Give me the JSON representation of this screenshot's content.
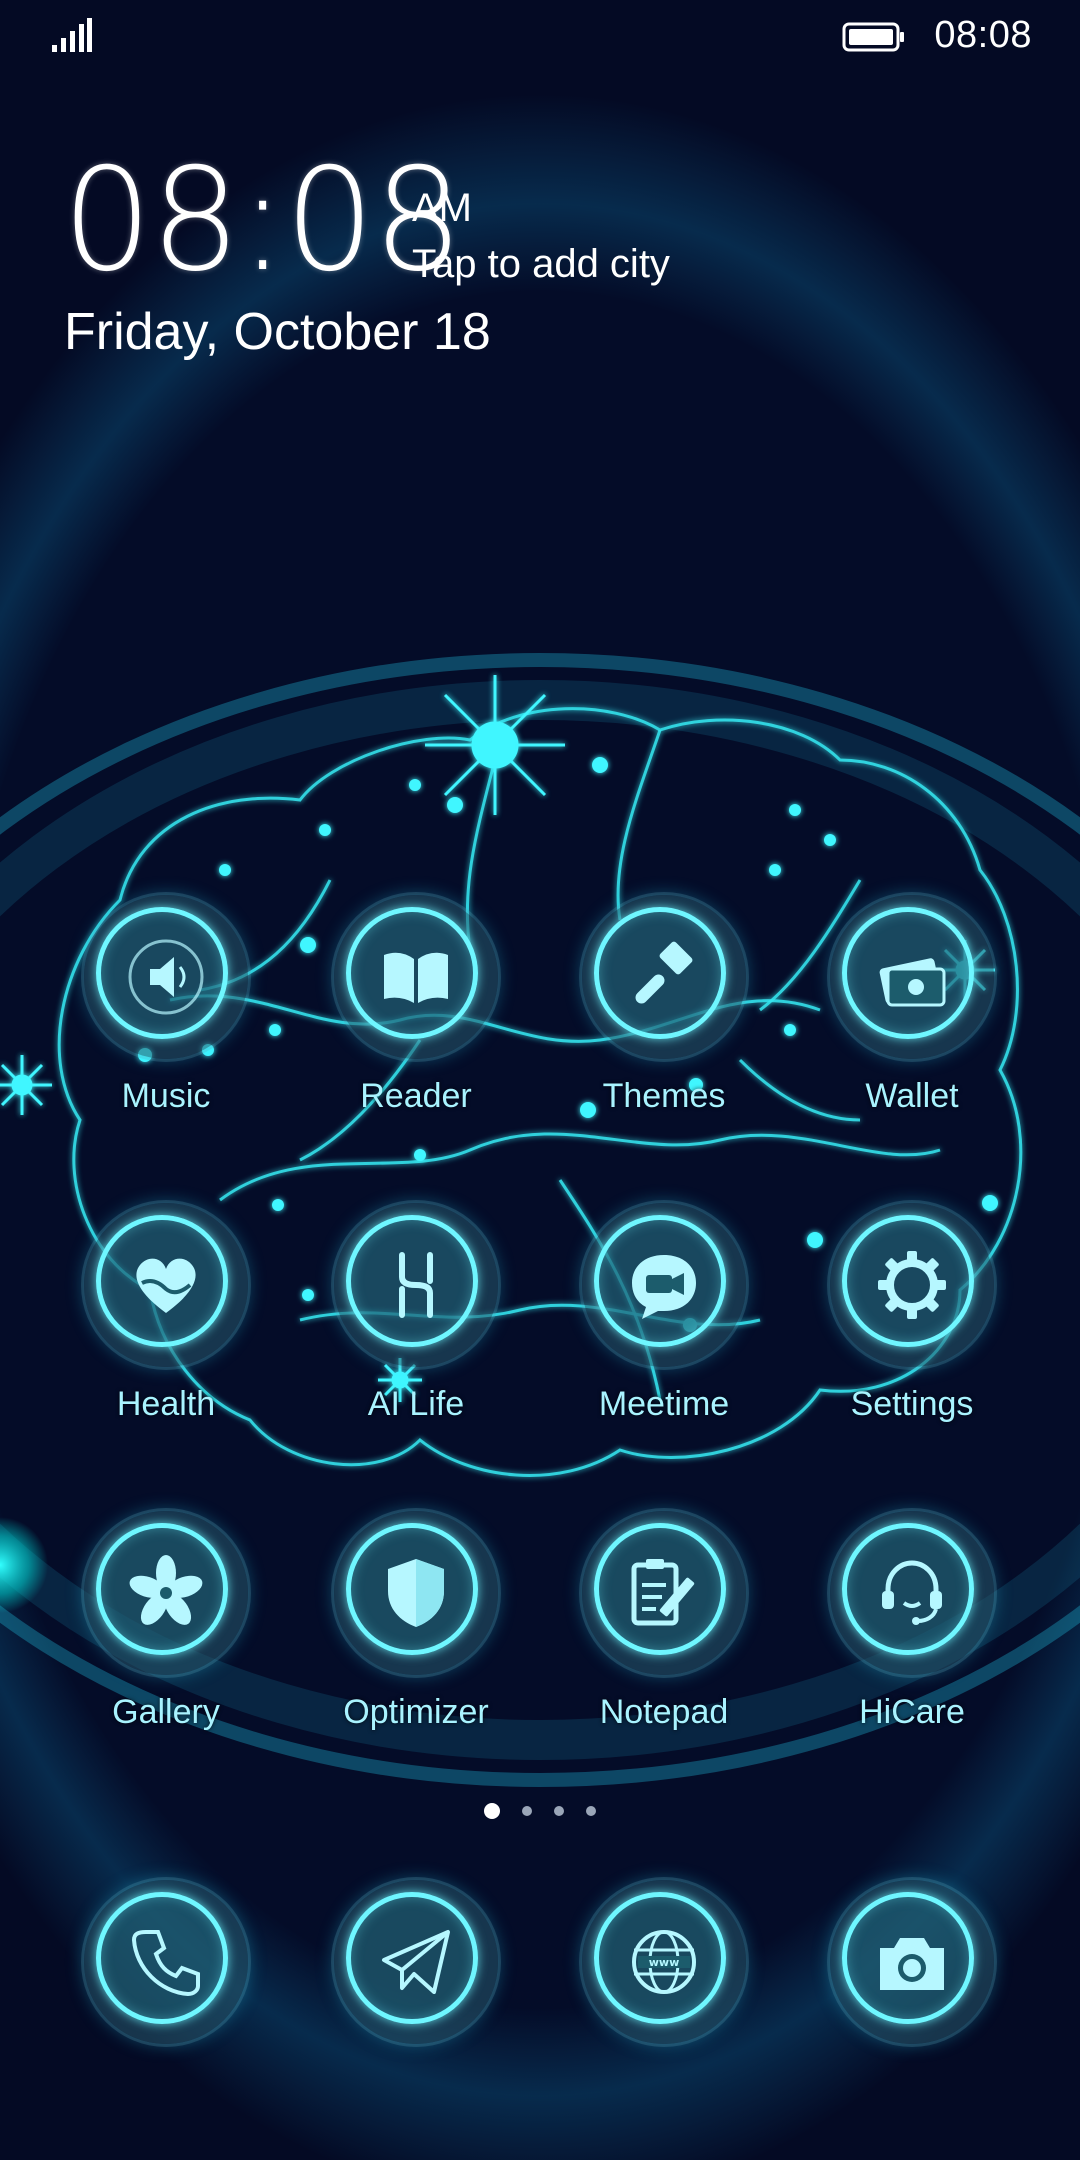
{
  "status_bar": {
    "time": "08:08",
    "signal_icon": "signal-icon",
    "battery_icon": "battery-icon"
  },
  "clock_widget": {
    "time": "08:08",
    "ampm": "AM",
    "city_prompt": "Tap to add city",
    "date": "Friday, October 18"
  },
  "apps": [
    {
      "label": "Music",
      "icon": "music-speaker-icon"
    },
    {
      "label": "Reader",
      "icon": "book-icon"
    },
    {
      "label": "Themes",
      "icon": "paintbrush-icon"
    },
    {
      "label": "Wallet",
      "icon": "wallet-icon"
    },
    {
      "label": "Health",
      "icon": "heart-icon"
    },
    {
      "label": "AI Life",
      "icon": "ai-life-icon"
    },
    {
      "label": "Meetime",
      "icon": "video-chat-icon"
    },
    {
      "label": "Settings",
      "icon": "gear-icon"
    },
    {
      "label": "Gallery",
      "icon": "flower-icon"
    },
    {
      "label": "Optimizer",
      "icon": "shield-icon"
    },
    {
      "label": "Notepad",
      "icon": "notepad-icon"
    },
    {
      "label": "HiCare",
      "icon": "headset-icon"
    }
  ],
  "page_indicator": {
    "pages": 4,
    "active": 1
  },
  "dock": [
    {
      "icon": "phone-icon"
    },
    {
      "icon": "send-icon"
    },
    {
      "icon": "globe-www-icon",
      "text": "www"
    },
    {
      "icon": "camera-icon"
    }
  ],
  "colors": {
    "background": "#040a24",
    "accent": "#6ff6ff",
    "label": "#a9f3ff"
  }
}
